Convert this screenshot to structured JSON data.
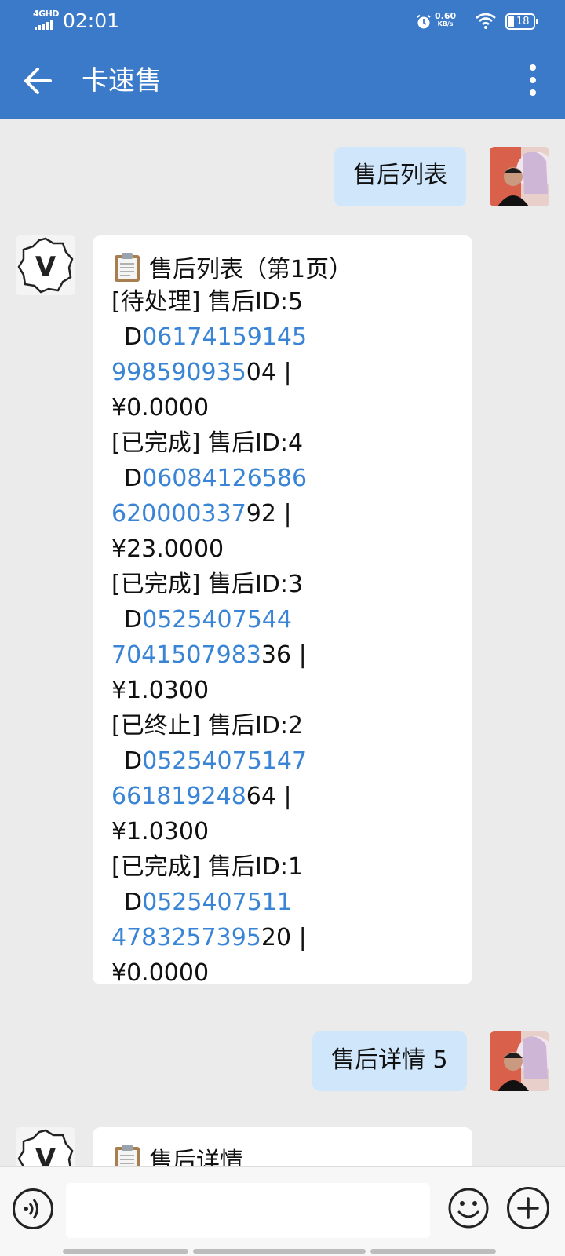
{
  "status": {
    "network": "4GHD",
    "time": "02:01",
    "net_speed_value": "0.60",
    "net_speed_unit": "KB/s",
    "battery": "18"
  },
  "header": {
    "title": "卡速售"
  },
  "messages": {
    "user1": "售后列表",
    "bot1": {
      "title": "售后列表（第1页）",
      "entries": [
        {
          "status_line": "[待处理] 售后ID:5",
          "prefix": "D",
          "link_a": "06174159145",
          "link_b": "99859093",
          "link_b_tail": "5",
          "suffix": "04 |",
          "amount": "¥0.0000"
        },
        {
          "status_line": "[已完成] 售后ID:4",
          "prefix": "D",
          "link_a": "06084126586",
          "link_b": "62000033",
          "link_b_tail": "7",
          "suffix": "92 |",
          "amount": "¥23.0000"
        },
        {
          "status_line": "[已完成] 售后ID:3",
          "prefix": "D",
          "link_a": "0525407544",
          "link_b": "70415079",
          "link_b_tail": "83",
          "suffix": "36 |",
          "amount": "¥1.0300"
        },
        {
          "status_line": "[已终止] 售后ID:2",
          "prefix": "D",
          "link_a": "05254075147",
          "link_b": "66181924",
          "link_b_tail": "8",
          "suffix": "64 |",
          "amount": "¥1.0300"
        },
        {
          "status_line": "[已完成] 售后ID:1",
          "prefix": "D",
          "link_a": "0525407511",
          "link_b": "47832573",
          "link_b_tail": "95",
          "suffix": "20 |",
          "amount": "¥0.0000"
        }
      ]
    },
    "user2": "售后详情 5",
    "bot2": {
      "title": "售后详情"
    }
  },
  "bot_avatar_letter": "V",
  "colors": {
    "header_bg": "#3b79c9",
    "chat_bg": "#ebebeb",
    "bubble_out": "#cfe6fb",
    "link": "#3a84d6"
  }
}
